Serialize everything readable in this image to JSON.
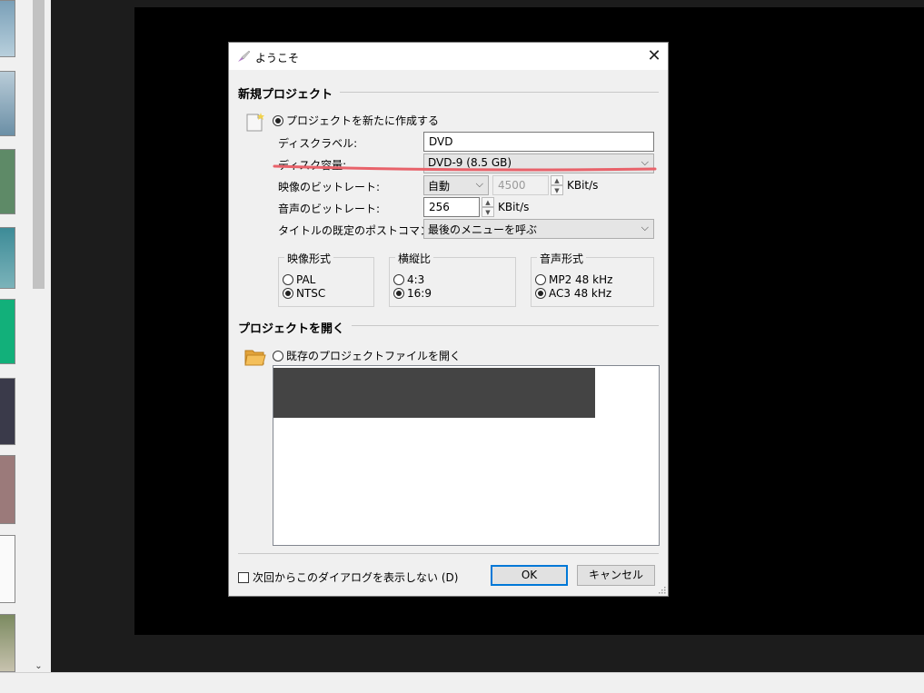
{
  "dialog": {
    "title": "ようこそ",
    "close_glyph": "✕",
    "new_project": {
      "section_title": "新規プロジェクト",
      "create_radio_label": "プロジェクトを新たに作成する",
      "disc_label_label": "ディスクラベル:",
      "disc_label_value": "DVD",
      "disc_capacity_label": "ディスク容量:",
      "disc_capacity_value": "DVD-9 (8.5 GB)",
      "video_bitrate_label": "映像のビットレート:",
      "video_bitrate_mode": "自動",
      "video_bitrate_value": "4500",
      "video_bitrate_unit": "KBit/s",
      "audio_bitrate_label": "音声のビットレート:",
      "audio_bitrate_value": "256",
      "audio_bitrate_unit": "KBit/s",
      "post_command_label": "タイトルの既定のポストコマンド:",
      "post_command_value": "最後のメニューを呼ぶ",
      "video_format": {
        "title": "映像形式",
        "options": [
          "PAL",
          "NTSC"
        ],
        "selected": "NTSC"
      },
      "aspect_ratio": {
        "title": "横縦比",
        "options": [
          "4:3",
          "16:9"
        ],
        "selected": "16:9"
      },
      "audio_format": {
        "title": "音声形式",
        "options": [
          "MP2 48 kHz",
          "AC3 48 kHz"
        ],
        "selected": "AC3 48 kHz"
      }
    },
    "open_project": {
      "section_title": "プロジェクトを開く",
      "open_radio_label": "既存のプロジェクトファイルを開く"
    },
    "dont_show_label": "次回からこのダイアログを表示しない (D)",
    "ok_label": "OK",
    "cancel_label": "キャンセル",
    "annotation_color": "#e8626a"
  }
}
